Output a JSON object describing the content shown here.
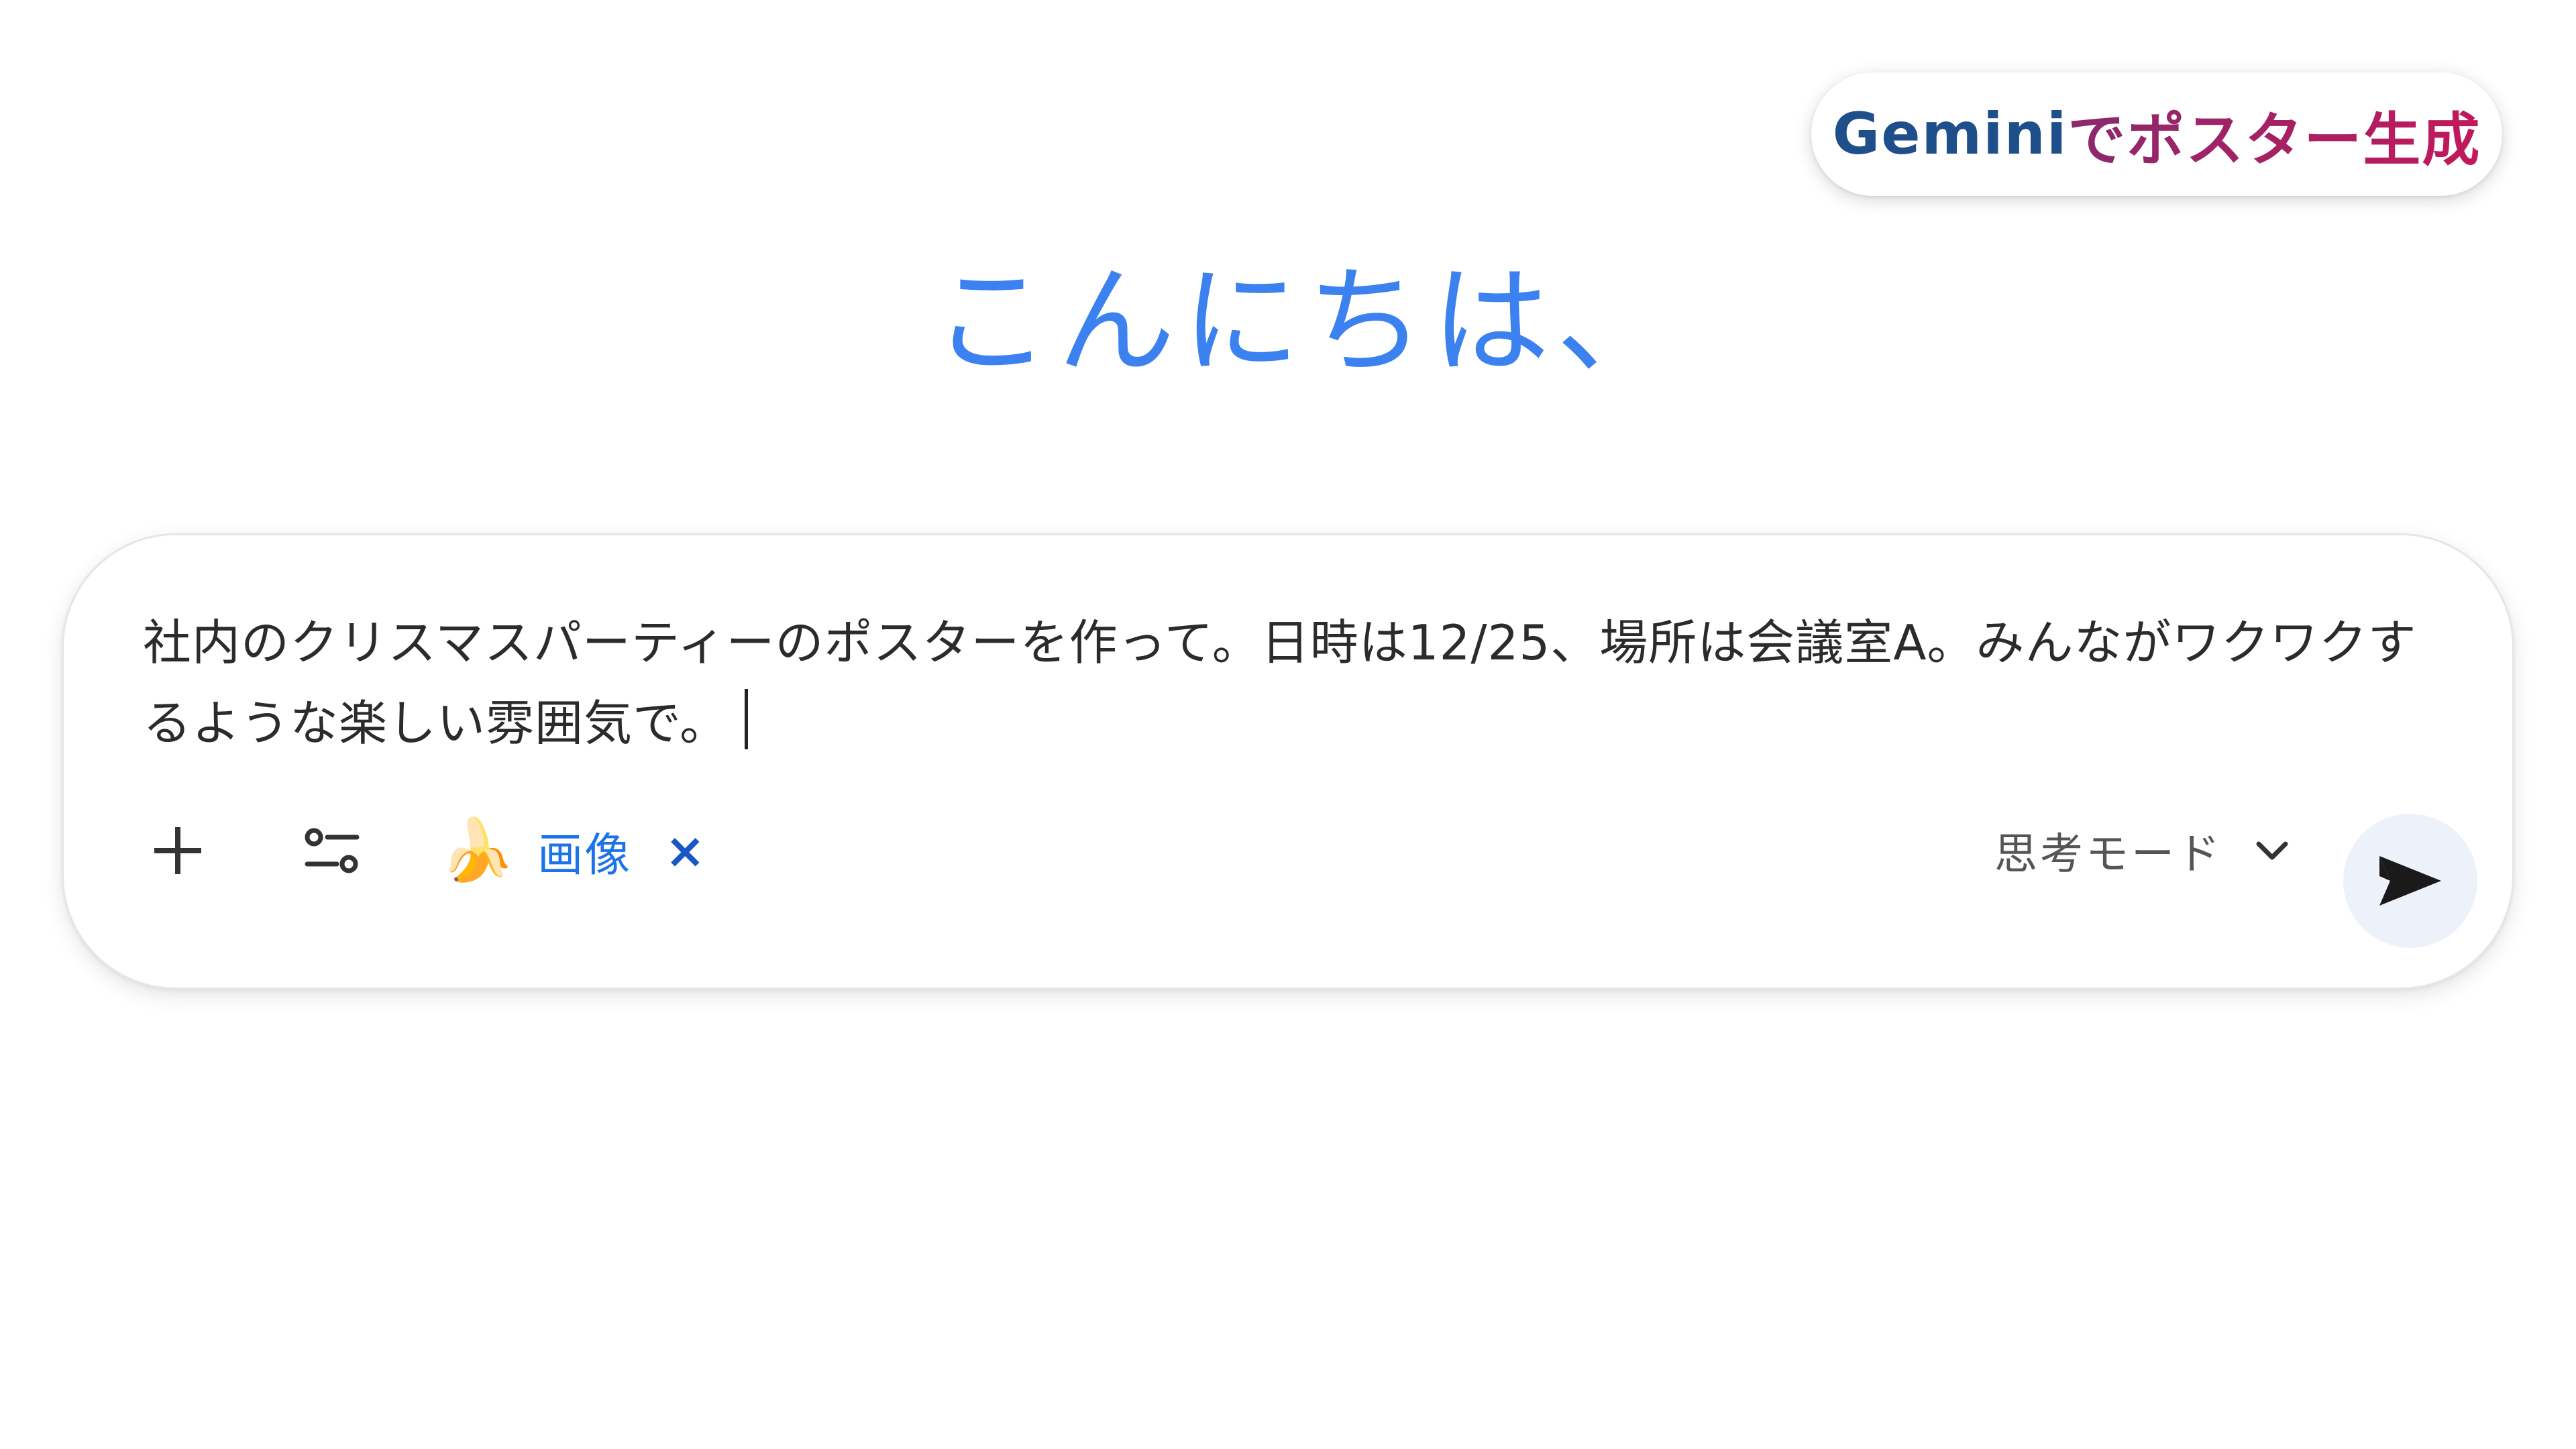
{
  "badge": {
    "brand": "Gemini",
    "rest": "でポスター生成"
  },
  "greeting": "こんにちは、",
  "prompt": {
    "text": "社内のクリスマスパーティーのポスターを作って。日時は12/25、場所は会議室A。みんながワクワクするような楽しい雰囲気で。"
  },
  "toolbar": {
    "add_icon": "plus-icon",
    "tools_icon": "tune-icon",
    "image_chip": {
      "emoji": "🍌",
      "label": "画像",
      "close": "×"
    },
    "mode": {
      "label": "思考モード",
      "icon": "chevron-down-icon"
    },
    "send_icon": "send-icon"
  },
  "colors": {
    "greeting": "#3b82f0",
    "brand": "#1f4f8a",
    "accent": "#c2185b",
    "chip": "#1a73e8",
    "send_bg": "#edf2fa"
  }
}
